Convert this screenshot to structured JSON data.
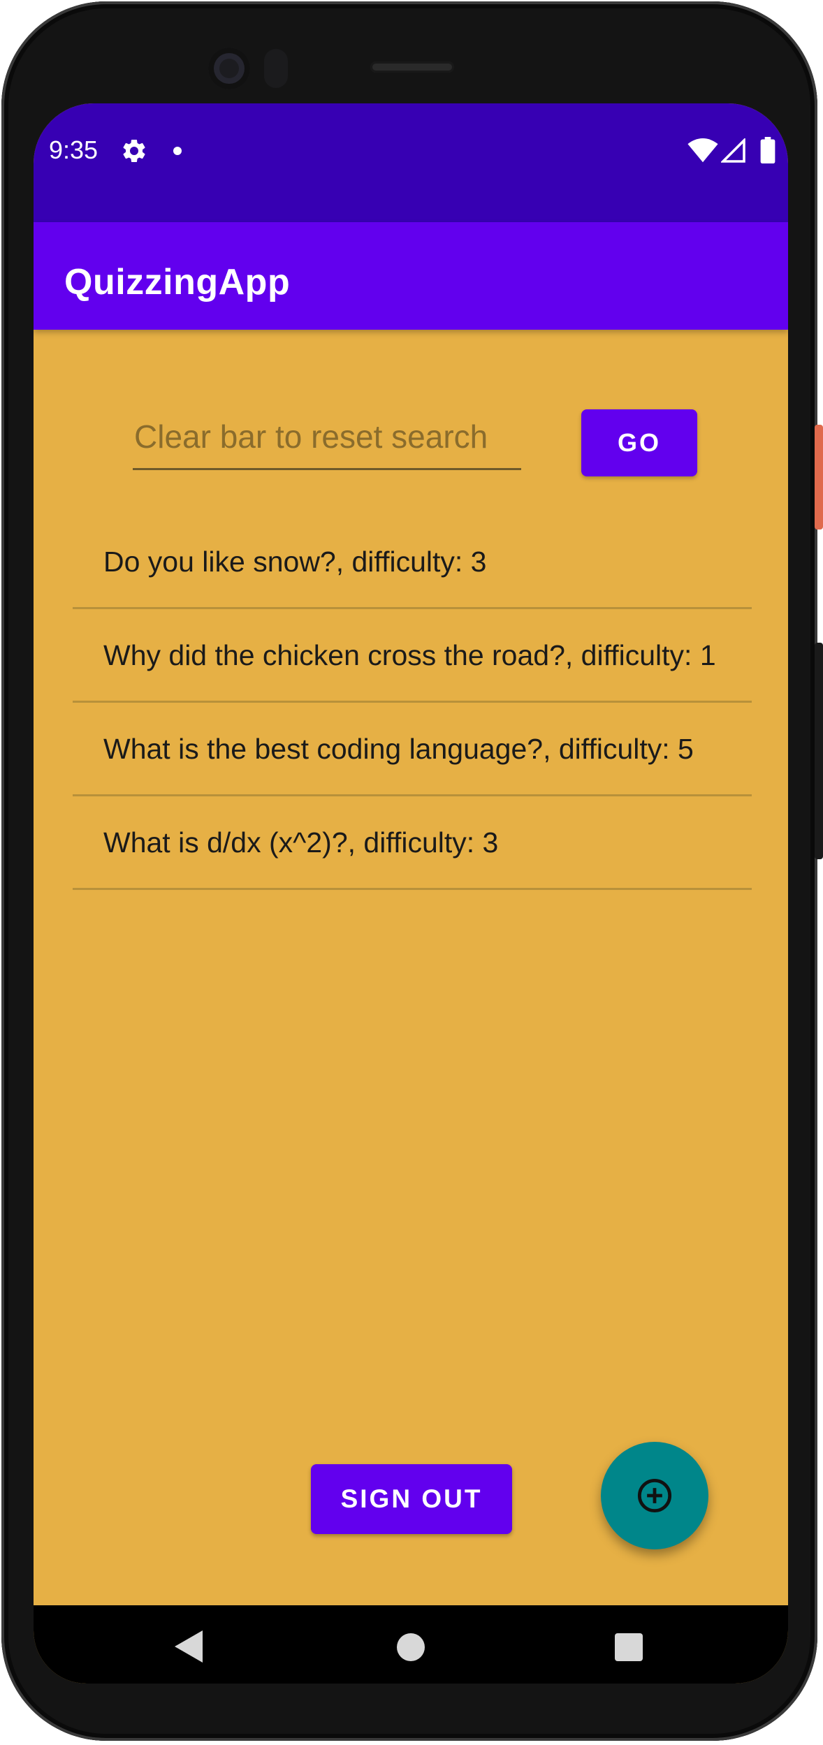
{
  "status_bar": {
    "time": "9:35",
    "icons": [
      "gear-icon",
      "notification-dot-icon",
      "wifi-icon",
      "cell-signal-icon",
      "battery-icon"
    ]
  },
  "app_bar": {
    "title": "QuizzingApp"
  },
  "search": {
    "placeholder": "Clear bar to reset search",
    "value": "",
    "go_label": "GO"
  },
  "questions": [
    {
      "text": "Do you like snow?, difficulty: 3"
    },
    {
      "text": "Why did the chicken cross the road?, difficulty: 1"
    },
    {
      "text": "What is the best coding language?, difficulty: 5"
    },
    {
      "text": "What is d/dx (x^2)?, difficulty: 3"
    }
  ],
  "actions": {
    "sign_out_label": "SIGN OUT",
    "fab_icon": "add-circle-icon"
  },
  "colors": {
    "status_bar": "#3700b3",
    "app_bar": "#6200ee",
    "background": "#e6b045",
    "button": "#6200ee",
    "fab": "#00868a"
  },
  "nav_bar": {
    "icons": [
      "back-icon",
      "home-icon",
      "recents-icon"
    ]
  }
}
